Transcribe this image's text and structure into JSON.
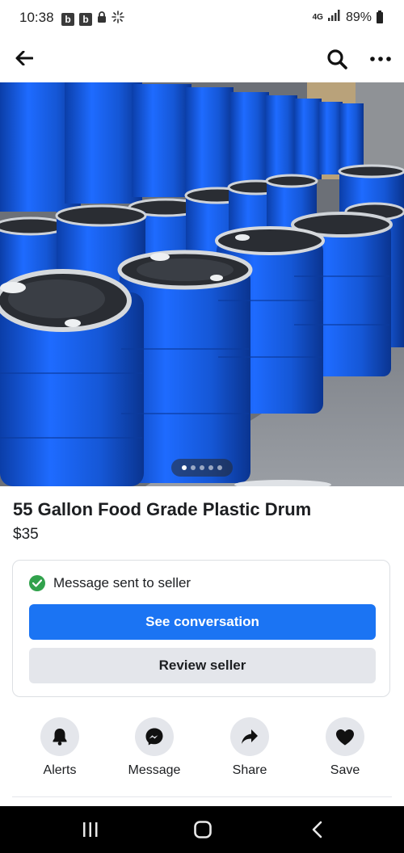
{
  "status_bar": {
    "time": "10:38",
    "icon_b1": "b",
    "icon_b2": "b",
    "network": "4G",
    "battery_text": "89%"
  },
  "app_bar": {
    "back_icon": "arrow-left-icon",
    "search_icon": "search-icon",
    "more_icon": "more-horizontal-icon"
  },
  "photo": {
    "carousel_total": 5,
    "carousel_active_index": 0
  },
  "listing": {
    "title": "55 Gallon Food Grade Plastic Drum",
    "price": "$35"
  },
  "seller_card": {
    "status_text": "Message sent to seller",
    "primary_button": "See conversation",
    "secondary_button": "Review seller"
  },
  "actions": [
    {
      "label": "Alerts",
      "icon": "bell-icon"
    },
    {
      "label": "Message",
      "icon": "messenger-icon"
    },
    {
      "label": "Share",
      "icon": "share-icon"
    },
    {
      "label": "Save",
      "icon": "heart-icon"
    }
  ],
  "colors": {
    "primary": "#1b74f3",
    "success": "#31a24c",
    "secondary_bg": "#e4e6eb",
    "drum_blue": "#1557d6"
  }
}
